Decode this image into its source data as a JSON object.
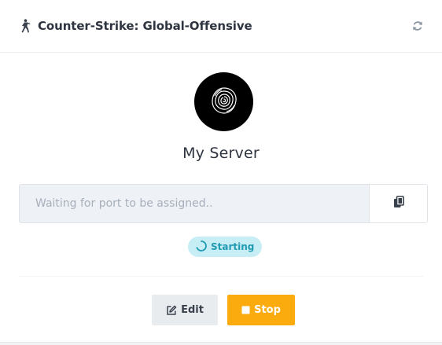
{
  "header": {
    "game_title": "Counter-Strike: Global-Offensive",
    "game_icon": "counter-strike-soldier-icon",
    "refresh_icon": "refresh-icon"
  },
  "server": {
    "avatar_icon": "rose-icon",
    "name": "My Server"
  },
  "address": {
    "value": "",
    "placeholder": "Waiting for port to be assigned..",
    "copy_icon": "copy-icon"
  },
  "status": {
    "label": "Starting",
    "icon": "spinner-icon"
  },
  "actions": {
    "edit_label": "Edit",
    "edit_icon": "edit-icon",
    "stop_label": "Stop",
    "stop_icon": "stop-icon"
  },
  "colors": {
    "stop_button": "#fbab0e",
    "status_badge_bg": "#c7eef5",
    "status_badge_text": "#1f9ab3",
    "avatar_bg": "#000000"
  }
}
